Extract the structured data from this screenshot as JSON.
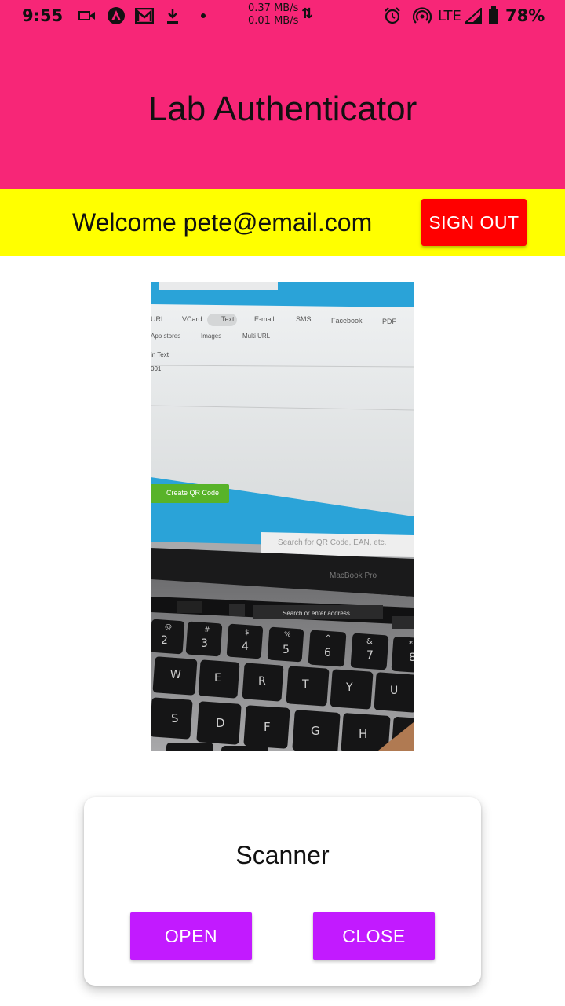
{
  "status_bar": {
    "time": "9:55",
    "net_up": "0.37 MB/s",
    "net_down": "0.01 MB/s",
    "network": "LTE",
    "battery": "78%"
  },
  "app": {
    "title": "Lab Authenticator",
    "welcome": "Welcome pete@email.com",
    "sign_out_label": "SIGN OUT"
  },
  "camera_preview": {
    "tabs": [
      "URL",
      "VCard",
      "Text",
      "E-mail",
      "SMS",
      "Facebook",
      "PDF"
    ],
    "tabs_row2": [
      "App stores",
      "Images",
      "Multi URL"
    ],
    "field_label": "in Text",
    "field_value": "001",
    "create_button": "Create QR Code",
    "search_placeholder": "Search for QR Code, EAN, etc.",
    "laptop_label": "MacBook Pro",
    "touchbar_address": "Search or enter address",
    "key_numbers": [
      "2",
      "3",
      "4",
      "5",
      "6",
      "7",
      "8"
    ],
    "key_symbols": [
      "@",
      "#",
      "$",
      "%",
      "^",
      "&",
      "*"
    ],
    "key_row_q": [
      "W",
      "E",
      "R",
      "T",
      "Y",
      "U"
    ],
    "key_row_a": [
      "S",
      "D",
      "F",
      "G",
      "H"
    ]
  },
  "scanner": {
    "title": "Scanner",
    "open_label": "OPEN",
    "close_label": "CLOSE"
  },
  "colors": {
    "header_pink": "#f72677",
    "welcome_yellow": "#ffff00",
    "sign_out_red": "#ff0000",
    "scanner_button_purple": "#c21aff"
  }
}
